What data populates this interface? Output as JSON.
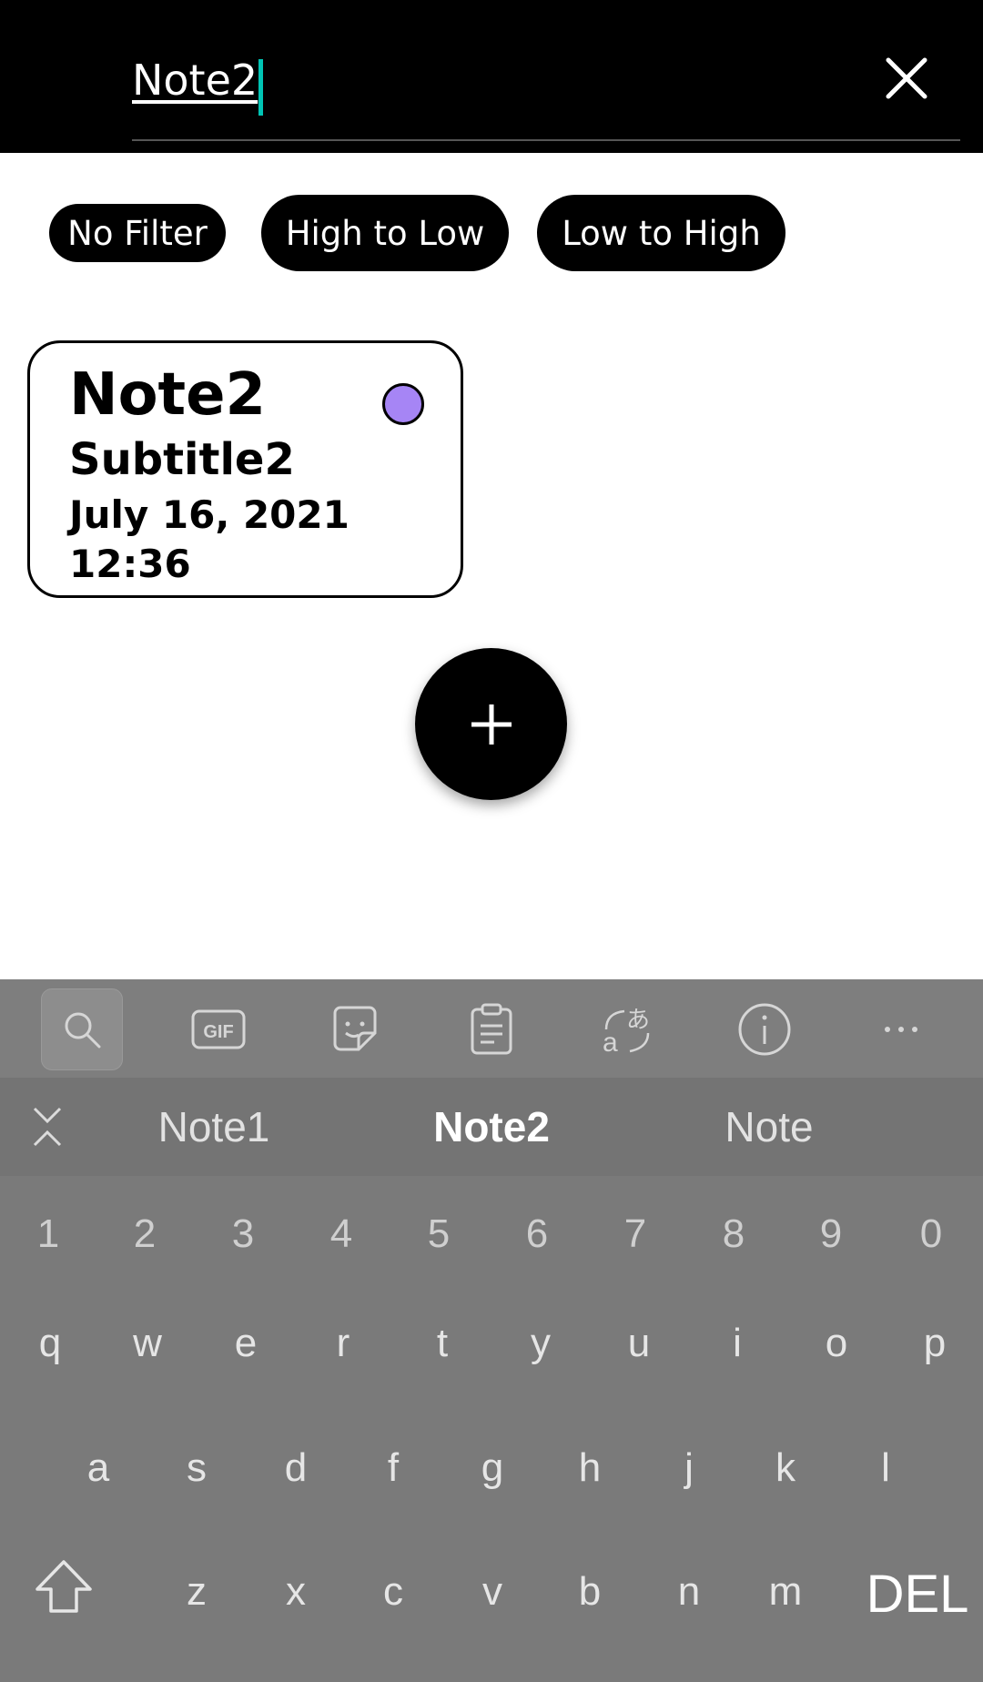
{
  "search": {
    "value": "Note2"
  },
  "filters": [
    {
      "label": "No Filter"
    },
    {
      "label": "High to Low"
    },
    {
      "label": "Low to High"
    }
  ],
  "note": {
    "title": "Note2",
    "subtitle": "Subtitle2",
    "date": "July 16, 2021",
    "time": "12:36",
    "color": "#a685f5"
  },
  "keyboard": {
    "toolbar": [
      "search-icon",
      "gif-icon",
      "sticker-icon",
      "clipboard-icon",
      "translate-icon",
      "info-icon",
      "more-icon"
    ],
    "gif_label": "GIF",
    "suggestions": [
      "Note1",
      "Note2",
      "Note"
    ],
    "numbers": [
      "1",
      "2",
      "3",
      "4",
      "5",
      "6",
      "7",
      "8",
      "9",
      "0"
    ],
    "row1": [
      "q",
      "w",
      "e",
      "r",
      "t",
      "y",
      "u",
      "i",
      "o",
      "p"
    ],
    "row2": [
      "a",
      "s",
      "d",
      "f",
      "g",
      "h",
      "j",
      "k",
      "l"
    ],
    "row3": [
      "z",
      "x",
      "c",
      "v",
      "b",
      "n",
      "m"
    ],
    "del_label": "DEL"
  }
}
